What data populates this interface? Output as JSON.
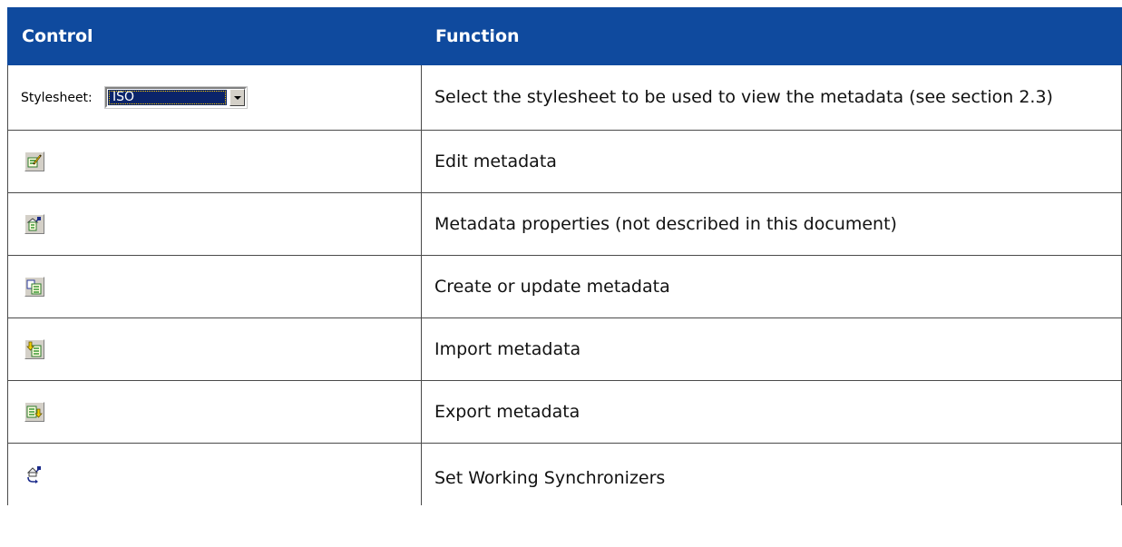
{
  "table": {
    "headers": [
      "Control",
      "Function"
    ],
    "stylesheet_control": {
      "label": "Stylesheet:",
      "value": "ISO"
    },
    "rows": [
      {
        "icon": "stylesheet-dropdown",
        "function": "Select the stylesheet to be used to view the metadata (see section 2.3)"
      },
      {
        "icon": "edit-metadata-icon",
        "function": "Edit metadata"
      },
      {
        "icon": "metadata-properties-icon",
        "function": "Metadata properties (not described in this document)"
      },
      {
        "icon": "create-update-metadata-icon",
        "function": "Create or update metadata"
      },
      {
        "icon": "import-metadata-icon",
        "function": "Import metadata"
      },
      {
        "icon": "export-metadata-icon",
        "function": "Export metadata"
      },
      {
        "icon": "set-working-synchronizers-icon",
        "function": "Set Working Synchronizers"
      }
    ]
  },
  "colors": {
    "header_bg": "#0f4a9e",
    "header_text": "#ffffff",
    "combo_selected": "#0a246a"
  }
}
